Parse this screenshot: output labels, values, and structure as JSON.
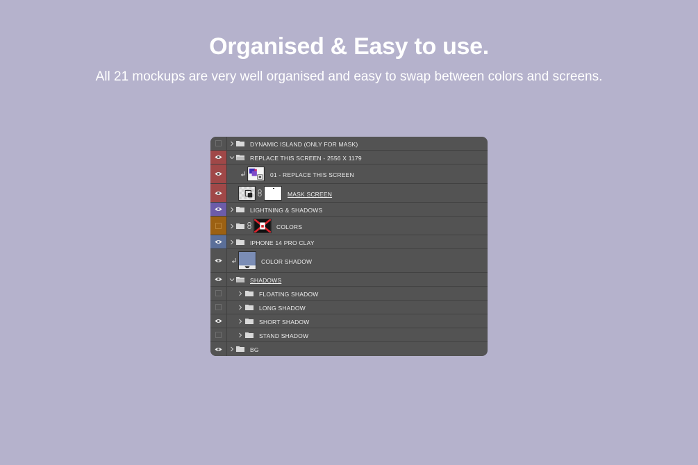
{
  "header": {
    "title": "Organised & Easy to use.",
    "subtitle": "All 21 mockups are very well organised and easy to swap between colors and screens."
  },
  "layers": [
    {
      "label": "DYNAMIC ISLAND (ONLY FOR MASK)",
      "visible": false,
      "color": "none",
      "type": "group",
      "expanded": false
    },
    {
      "label": "REPLACE THIS SCREEN - 2556 X 1179",
      "visible": true,
      "color": "red",
      "type": "group",
      "expanded": true
    },
    {
      "label": "01 - REPLACE THIS SCREEN",
      "visible": true,
      "color": "red",
      "type": "smart-object",
      "clipped": true
    },
    {
      "label": "MASK SCREEN",
      "visible": true,
      "color": "red",
      "type": "masked-layer",
      "underlined": true
    },
    {
      "label": "LIGHTNING & SHADOWS",
      "visible": true,
      "color": "violet",
      "type": "group",
      "expanded": false
    },
    {
      "label": "COLORS",
      "visible": false,
      "color": "orange",
      "type": "group-with-mask",
      "expanded": false
    },
    {
      "label": "IPHONE 14 PRO CLAY",
      "visible": true,
      "color": "blue",
      "type": "group",
      "expanded": false
    },
    {
      "label": "COLOR SHADOW",
      "visible": true,
      "color": "none",
      "type": "fill-layer",
      "clipped": true
    },
    {
      "label": "SHADOWS",
      "visible": true,
      "color": "none",
      "type": "group",
      "expanded": true,
      "underlined": true
    },
    {
      "label": "FLOATING SHADOW",
      "visible": false,
      "color": "none",
      "type": "subgroup"
    },
    {
      "label": "LONG SHADOW",
      "visible": false,
      "color": "none",
      "type": "subgroup"
    },
    {
      "label": "SHORT SHADOW",
      "visible": true,
      "color": "none",
      "type": "subgroup"
    },
    {
      "label": "STAND SHADOW",
      "visible": false,
      "color": "none",
      "type": "subgroup"
    },
    {
      "label": "BG",
      "visible": true,
      "color": "none",
      "type": "group",
      "expanded": false
    }
  ]
}
